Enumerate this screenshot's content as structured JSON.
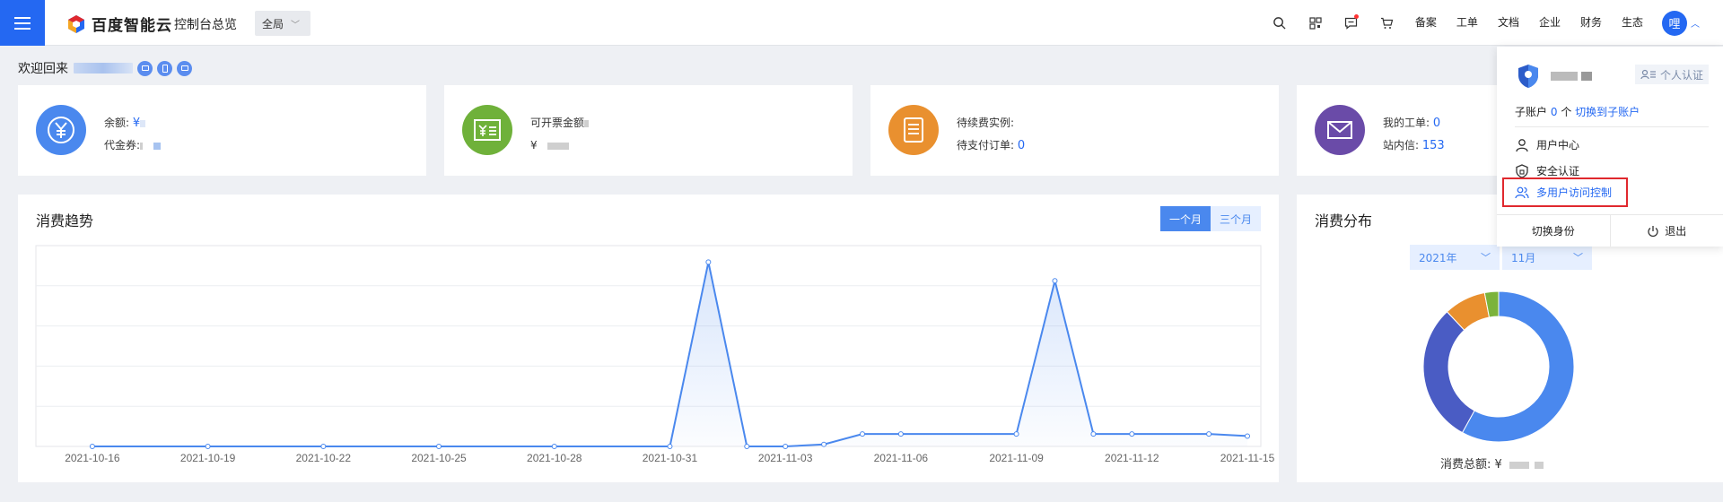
{
  "topbar": {
    "brand": "百度智能云",
    "console_title": "控制台总览",
    "region": "全局",
    "links": [
      "备案",
      "工单",
      "文档",
      "企业",
      "财务",
      "生态"
    ],
    "avatar_text": "哩"
  },
  "welcome": {
    "text": "欢迎回来"
  },
  "cards": {
    "balance_label": "余额:",
    "balance_prefix": "¥",
    "voucher_label": "代金券:",
    "invoice_label": "可开票金额",
    "invoice_prefix": "¥",
    "renew_label": "待续费实例:",
    "unpaid_label": "待支付订单:",
    "unpaid_value": "0",
    "tickets_label": "我的工单:",
    "tickets_value": "0",
    "messages_label": "站内信:",
    "messages_value": "153"
  },
  "trend": {
    "title": "消费趋势",
    "range_month": "一个月",
    "range_quarter": "三个月"
  },
  "chart_data": {
    "type": "area",
    "x_tick_labels": [
      "2021-10-16",
      "2021-10-19",
      "2021-10-22",
      "2021-10-25",
      "2021-10-28",
      "2021-10-31",
      "2021-11-03",
      "2021-11-06",
      "2021-11-09",
      "2021-11-12",
      "2021-11-15"
    ],
    "x": [
      "2021-10-16",
      "2021-10-19",
      "2021-10-22",
      "2021-10-25",
      "2021-10-28",
      "2021-10-31",
      "2021-11-01",
      "2021-11-02",
      "2021-11-03",
      "2021-11-04",
      "2021-11-06",
      "2021-11-09",
      "2021-11-10",
      "2021-11-12",
      "2021-11-14",
      "2021-11-15"
    ],
    "values": [
      0,
      0,
      0,
      0,
      0,
      0,
      89,
      0,
      0,
      0.6,
      2.1,
      2.1,
      81,
      2.2,
      2.1,
      2.1,
      1
    ],
    "series": [
      {
        "points": [
          [
            "2021-10-16",
            0
          ],
          [
            "2021-10-19",
            0
          ],
          [
            "2021-10-22",
            0
          ],
          [
            "2021-10-25",
            0
          ],
          [
            "2021-10-28",
            0
          ],
          [
            "2021-10-31",
            0
          ],
          [
            "2021-11-01",
            89
          ],
          [
            "2021-11-02",
            0
          ],
          [
            "2021-11-03",
            0
          ],
          [
            "2021-11-04",
            1
          ],
          [
            "2021-11-05",
            6
          ],
          [
            "2021-11-06",
            6
          ],
          [
            "2021-11-09",
            6
          ],
          [
            "2021-11-10",
            80
          ],
          [
            "2021-11-11",
            6
          ],
          [
            "2021-11-12",
            6
          ],
          [
            "2021-11-14",
            6
          ],
          [
            "2021-11-15",
            5
          ]
        ]
      }
    ],
    "ylim": [
      0,
      100
    ],
    "grid": true,
    "color": "#4a88ee"
  },
  "distribution": {
    "title": "消费分布",
    "year": "2021年",
    "month": "11月",
    "total_label": "消费总额:",
    "total_prefix": "¥",
    "donut": {
      "type": "pie",
      "slices": [
        {
          "value": 58,
          "color": "#4a88ee"
        },
        {
          "value": 30,
          "color": "#4a5cc4"
        },
        {
          "value": 9,
          "color": "#e9902f"
        },
        {
          "value": 3,
          "color": "#7bb33b"
        }
      ]
    }
  },
  "dropdown": {
    "verify_label": "个人认证",
    "subaccount_label": "子账户",
    "subaccount_count": "0",
    "subaccount_unit": "个",
    "switch_sub": "切换到子账户",
    "user_center": "用户中心",
    "security": "安全认证",
    "multi_user": "多用户访问控制",
    "switch_identity": "切换身份",
    "logout": "退出"
  },
  "colors": {
    "accent": "#2468f2",
    "highlight_border": "#e0282e"
  }
}
